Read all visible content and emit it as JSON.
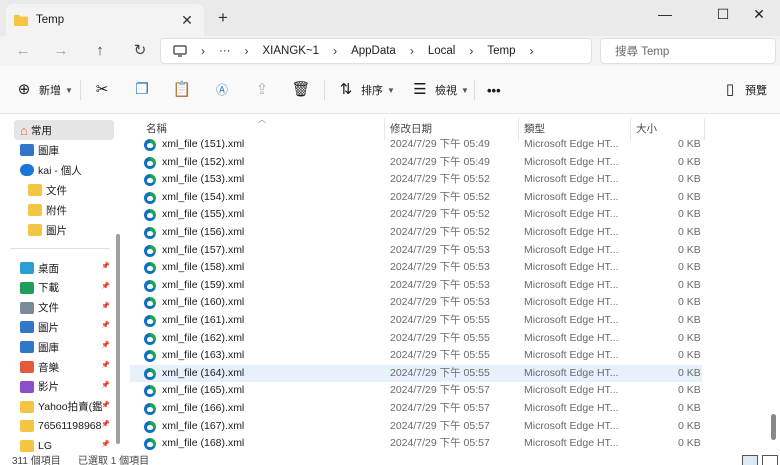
{
  "window": {
    "tab_title": "Temp",
    "close_tab": "✕",
    "new_tab": "+",
    "minimize": "—",
    "maximize": "☐",
    "close": "✕"
  },
  "nav": {
    "back": "←",
    "forward": "→",
    "up": "↑",
    "refresh": "↻",
    "breadcrumbs": [
      "XIANGK~1",
      "AppData",
      "Local",
      "Temp"
    ],
    "overflow": "···",
    "search_placeholder": "搜尋 Temp"
  },
  "toolbar": {
    "new_label": "新增",
    "sort_label": "排序",
    "view_label": "檢視",
    "more": "•••",
    "preview_label": "預覽"
  },
  "sidebar": {
    "home": "常用",
    "gallery": "圖庫",
    "onedrive": "kai - 個人",
    "od_folders": [
      "文件",
      "附件",
      "圖片"
    ],
    "quick": [
      {
        "label": "桌面",
        "color": "#2a9fd6"
      },
      {
        "label": "下載",
        "color": "#1e9e5a"
      },
      {
        "label": "文件",
        "color": "#7a8a99"
      },
      {
        "label": "圖片",
        "color": "#2e78c7"
      },
      {
        "label": "圖庫",
        "color": "#2e78c7"
      },
      {
        "label": "音樂",
        "color": "#e35b3a"
      },
      {
        "label": "影片",
        "color": "#8b4fc9"
      },
      {
        "label": "Yahoo拍賣(鑑",
        "color": "#f4c542"
      },
      {
        "label": "76561198968",
        "color": "#f4c542"
      },
      {
        "label": "LG",
        "color": "#f4c542"
      }
    ]
  },
  "columns": {
    "name": "名稱",
    "modified": "修改日期",
    "type": "類型",
    "size": "大小"
  },
  "files": [
    {
      "name": "xml_file (151).xml",
      "date": "2024/7/29 下午 05:49",
      "type": "Microsoft Edge HT...",
      "size": "0 KB"
    },
    {
      "name": "xml_file (152).xml",
      "date": "2024/7/29 下午 05:49",
      "type": "Microsoft Edge HT...",
      "size": "0 KB"
    },
    {
      "name": "xml_file (153).xml",
      "date": "2024/7/29 下午 05:52",
      "type": "Microsoft Edge HT...",
      "size": "0 KB"
    },
    {
      "name": "xml_file (154).xml",
      "date": "2024/7/29 下午 05:52",
      "type": "Microsoft Edge HT...",
      "size": "0 KB"
    },
    {
      "name": "xml_file (155).xml",
      "date": "2024/7/29 下午 05:52",
      "type": "Microsoft Edge HT...",
      "size": "0 KB"
    },
    {
      "name": "xml_file (156).xml",
      "date": "2024/7/29 下午 05:52",
      "type": "Microsoft Edge HT...",
      "size": "0 KB"
    },
    {
      "name": "xml_file (157).xml",
      "date": "2024/7/29 下午 05:53",
      "type": "Microsoft Edge HT...",
      "size": "0 KB"
    },
    {
      "name": "xml_file (158).xml",
      "date": "2024/7/29 下午 05:53",
      "type": "Microsoft Edge HT...",
      "size": "0 KB"
    },
    {
      "name": "xml_file (159).xml",
      "date": "2024/7/29 下午 05:53",
      "type": "Microsoft Edge HT...",
      "size": "0 KB"
    },
    {
      "name": "xml_file (160).xml",
      "date": "2024/7/29 下午 05:53",
      "type": "Microsoft Edge HT...",
      "size": "0 KB"
    },
    {
      "name": "xml_file (161).xml",
      "date": "2024/7/29 下午 05:55",
      "type": "Microsoft Edge HT...",
      "size": "0 KB"
    },
    {
      "name": "xml_file (162).xml",
      "date": "2024/7/29 下午 05:55",
      "type": "Microsoft Edge HT...",
      "size": "0 KB"
    },
    {
      "name": "xml_file (163).xml",
      "date": "2024/7/29 下午 05:55",
      "type": "Microsoft Edge HT...",
      "size": "0 KB"
    },
    {
      "name": "xml_file (164).xml",
      "date": "2024/7/29 下午 05:55",
      "type": "Microsoft Edge HT...",
      "size": "0 KB",
      "selected": true
    },
    {
      "name": "xml_file (165).xml",
      "date": "2024/7/29 下午 05:57",
      "type": "Microsoft Edge HT...",
      "size": "0 KB"
    },
    {
      "name": "xml_file (166).xml",
      "date": "2024/7/29 下午 05:57",
      "type": "Microsoft Edge HT...",
      "size": "0 KB"
    },
    {
      "name": "xml_file (167).xml",
      "date": "2024/7/29 下午 05:57",
      "type": "Microsoft Edge HT...",
      "size": "0 KB"
    },
    {
      "name": "xml_file (168).xml",
      "date": "2024/7/29 下午 05:57",
      "type": "Microsoft Edge HT...",
      "size": "0 KB"
    }
  ],
  "status": {
    "count": "311 個項目",
    "selected": "已選取 1 個項目"
  }
}
